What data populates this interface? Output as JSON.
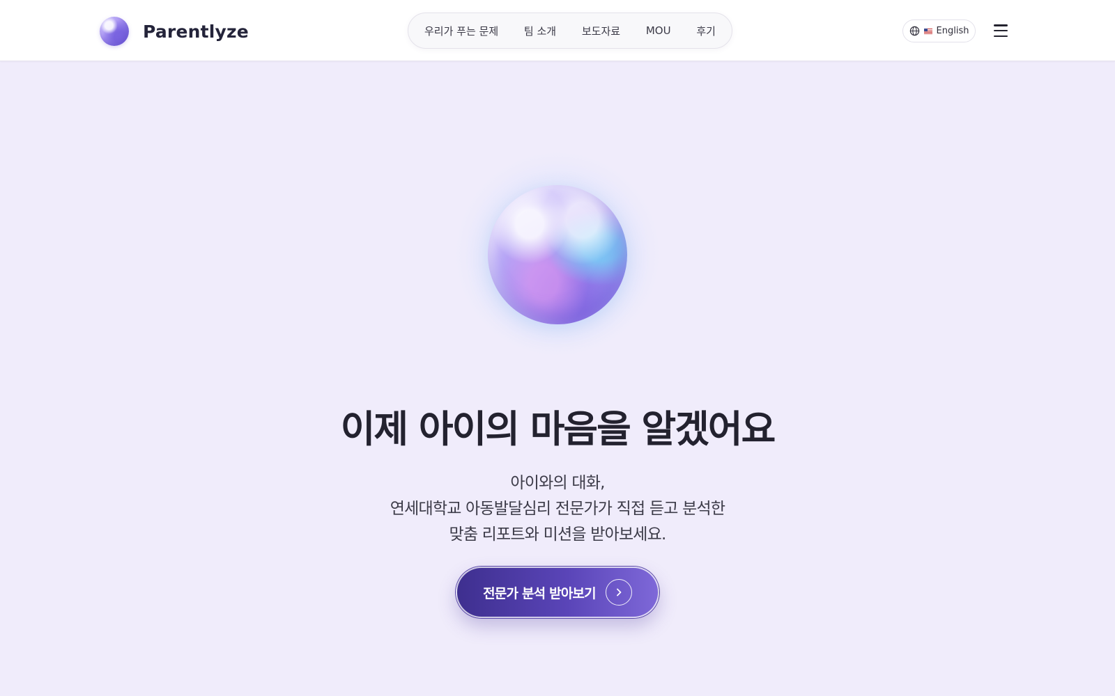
{
  "header": {
    "brand": "Parentlyze",
    "nav": [
      {
        "label": "우리가 푸는 문제"
      },
      {
        "label": "팀 소개"
      },
      {
        "label": "보도자료"
      },
      {
        "label": "MOU"
      },
      {
        "label": "후기"
      }
    ],
    "language": "English",
    "icons": {
      "logo": "orb-logo-icon",
      "language": "globe-icon",
      "flag": "us-flag-icon",
      "menu": "hamburger-menu-icon"
    }
  },
  "hero": {
    "headline": "이제 아이의 마음을 알겠어요",
    "subtext": [
      "아이와의 대화,",
      "연세대학교 아동발달심리 전문가가 직접 듣고 분석한",
      "맞춤 리포트와 미션을 받아보세요."
    ],
    "cta": "전문가 분석 받아보기",
    "cta_icon": "chevron-right-icon"
  },
  "colors": {
    "background": "#f0ecfb",
    "accent": "#4f3ea6",
    "text": "#23222f"
  }
}
